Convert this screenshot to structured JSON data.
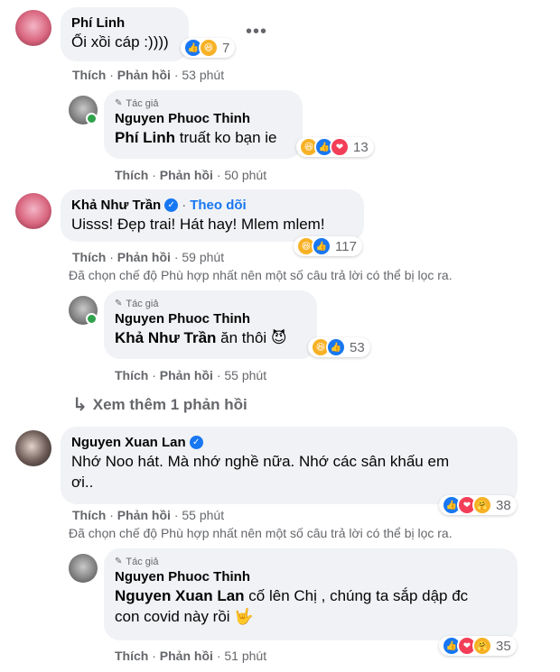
{
  "labels": {
    "like": "Thích",
    "reply": "Phản hồi",
    "dot": "·",
    "author_tag": "Tác giả",
    "follow": "Theo dõi"
  },
  "filter_notice": "Đã chọn chế độ Phù hợp nhất nên một số câu trả lời có thể bị lọc ra.",
  "comments": [
    {
      "name": "Phí Linh",
      "text": "Ối xồi cáp :))))",
      "time": "53 phút",
      "reactions": [
        "like-icon",
        "haha-icon"
      ],
      "reaction_count": "7"
    },
    {
      "name": "Nguyen Phuoc Thinh",
      "mention": "Phí Linh",
      "text": " truất ko bạn ie",
      "time": "50 phút",
      "reactions": [
        "haha-icon",
        "like-icon",
        "love-icon"
      ],
      "reaction_count": "13"
    },
    {
      "name": "Khả Như Trần",
      "text": "Uisss! Đẹp trai! Hát hay! Mlem mlem!",
      "time": "59 phút",
      "reactions": [
        "haha-icon",
        "like-icon"
      ],
      "reaction_count": "117"
    },
    {
      "name": "Nguyen Phuoc Thinh",
      "mention": "Khả Như Trần",
      "text": " ăn thôi 😈",
      "time": "55 phút",
      "reactions": [
        "haha-icon",
        "like-icon"
      ],
      "reaction_count": "53"
    },
    {
      "name": "Nguyen Xuan Lan",
      "text_line1": "Nhớ Noo hát. Mà nhớ nghề nữa. Nhớ các sân khấu em",
      "text_line2": "ơi..",
      "time": "55 phút",
      "reactions": [
        "like-icon",
        "love-icon",
        "care-icon"
      ],
      "reaction_count": "38"
    },
    {
      "name": "Nguyen Phuoc Thinh",
      "mention": "Nguyen Xuan Lan",
      "text_line1": " cố lên Chị , chúng ta sắp dập đc",
      "text_line2": "con covid này rồi 🤟",
      "time": "51 phút",
      "reactions": [
        "like-icon",
        "love-icon",
        "care-icon"
      ],
      "reaction_count": "35"
    }
  ],
  "more_replies": "Xem thêm 1 phản hồi",
  "colors": {
    "bubble": "#f0f2f5",
    "link": "#1877f2",
    "meta": "#65676b",
    "online": "#31a24c"
  }
}
